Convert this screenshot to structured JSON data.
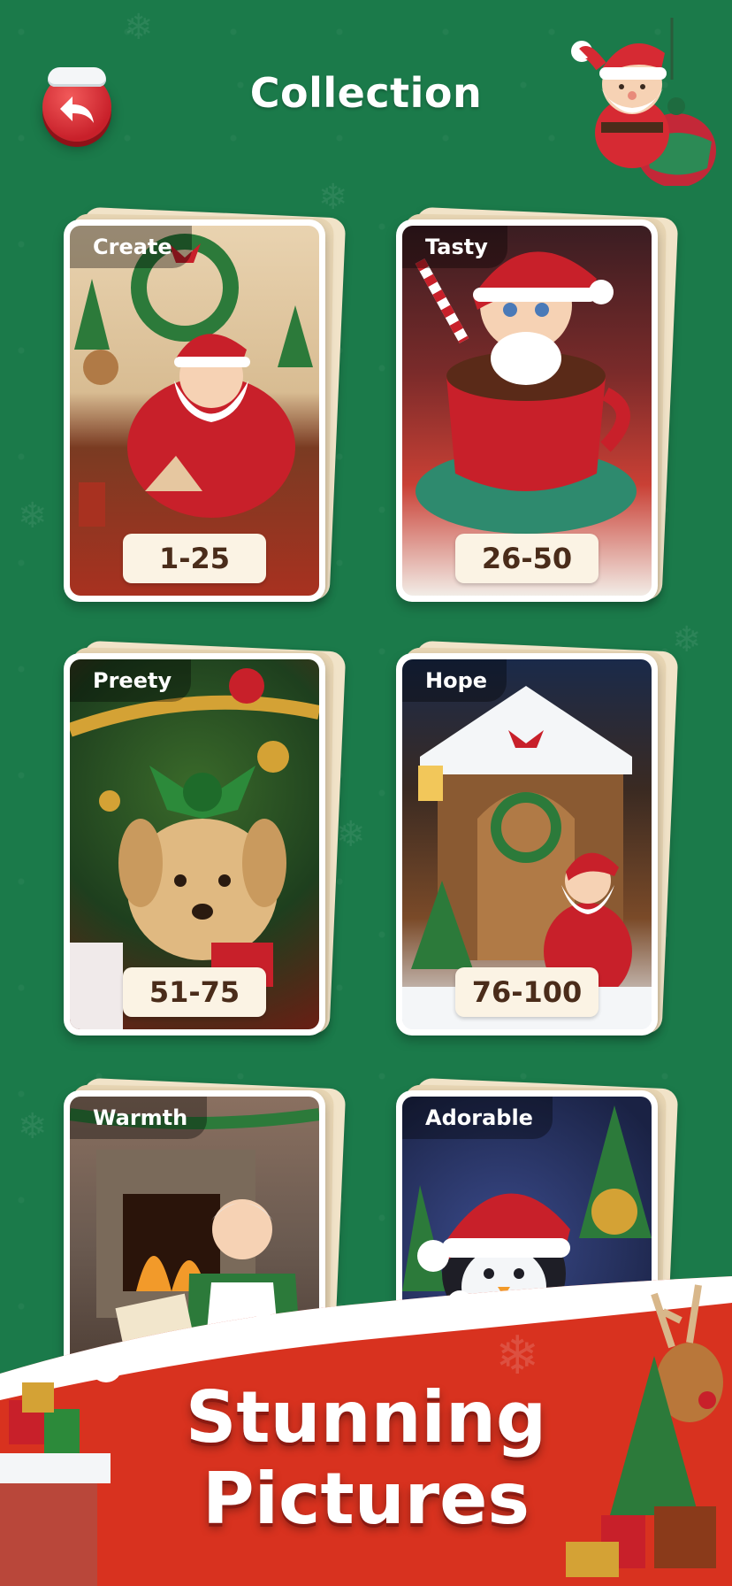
{
  "header": {
    "title": "Collection",
    "back_icon": "back-arrow-icon",
    "mascot": "santa-with-gift-bag"
  },
  "collections": [
    {
      "name": "Create",
      "range": "1-25",
      "theme": "santa-painting-toys"
    },
    {
      "name": "Tasty",
      "range": "26-50",
      "theme": "boy-with-hot-cocoa"
    },
    {
      "name": "Preety",
      "range": "51-75",
      "theme": "puppy-with-green-bow"
    },
    {
      "name": "Hope",
      "range": "76-100",
      "theme": "santa-at-snowy-cabin"
    },
    {
      "name": "Warmth",
      "range": "",
      "theme": "grandma-by-fireplace"
    },
    {
      "name": "Adorable",
      "range": "",
      "theme": "penguin-in-santa-hat"
    }
  ],
  "banner": {
    "line1": "Stunning",
    "line2": "Pictures"
  },
  "colors": {
    "background": "#1b7a4a",
    "back_button": "#d62a33",
    "banner_red": "#d8321f",
    "label_bg": "#fbf3e4",
    "label_text": "#4a2c1a"
  }
}
